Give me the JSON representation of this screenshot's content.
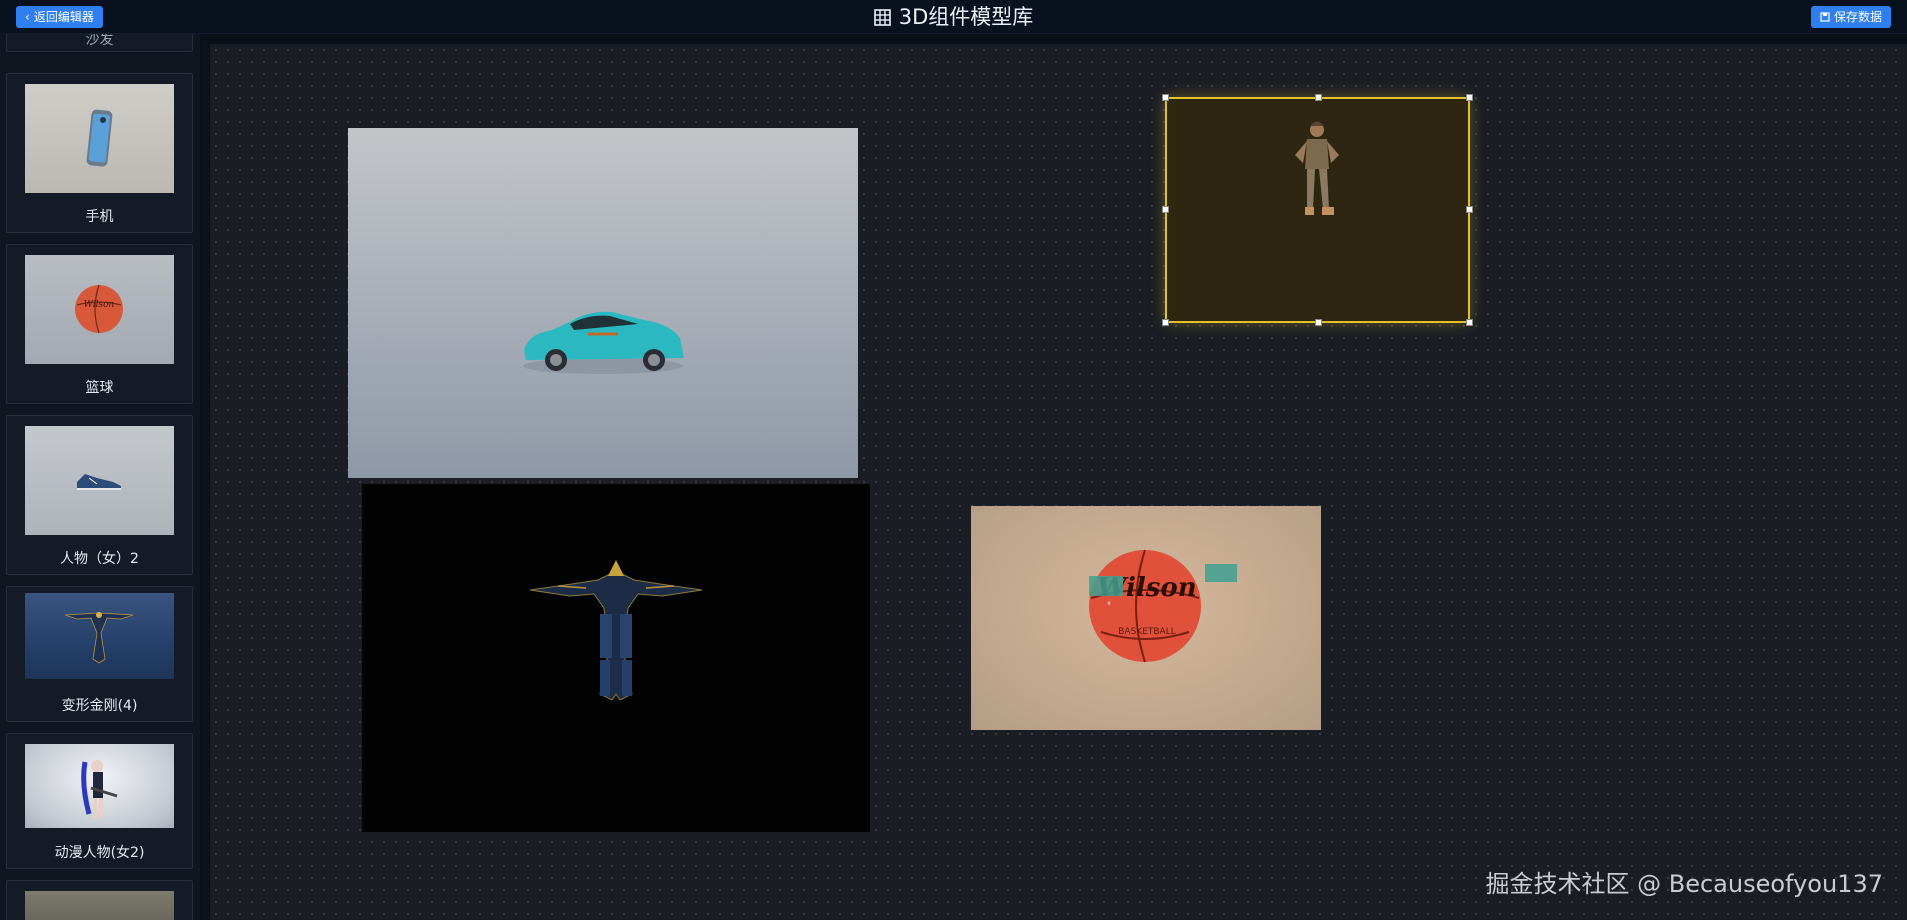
{
  "header": {
    "back_label": "返回编辑器",
    "title": "3D组件模型库",
    "save_label": "保存数据"
  },
  "sidebar": {
    "partial_top_label": "沙发",
    "items": [
      {
        "label": "手机"
      },
      {
        "label": "篮球"
      },
      {
        "label": "人物（女）2"
      },
      {
        "label": "变形金刚(4)"
      },
      {
        "label": "动漫人物(女2)"
      }
    ]
  },
  "watermark": "掘金技术社区 @ Becauseofyou137",
  "colors": {
    "accent": "#2f7ff0",
    "selection": "#e4c22e",
    "canvas_bg": "#1a1d23"
  }
}
